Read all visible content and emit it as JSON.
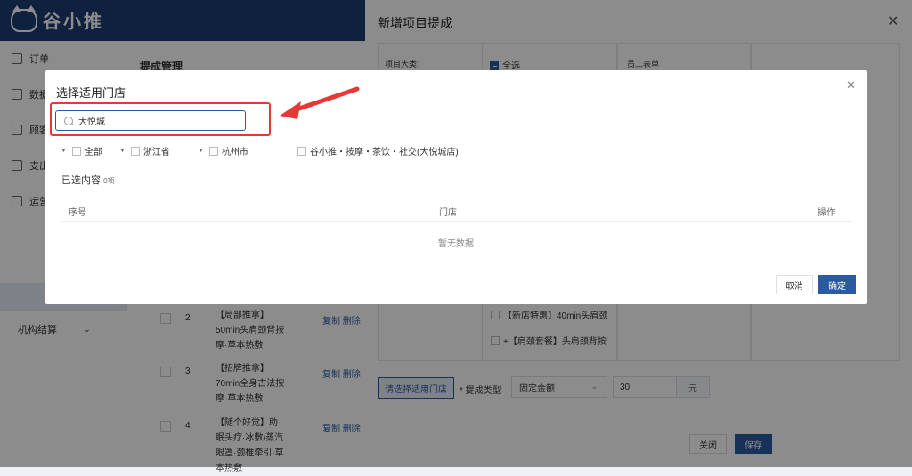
{
  "app": {
    "logo_text": "谷小推"
  },
  "sidebar": {
    "items": [
      {
        "label": "订单"
      },
      {
        "label": "数据"
      },
      {
        "label": "顾客"
      },
      {
        "label": "支出"
      },
      {
        "label": "运营"
      },
      {
        "label": "机构结算"
      }
    ]
  },
  "page": {
    "title": "提成管理",
    "rows": [
      {
        "num": "2",
        "text": "【局部推拿】50min头肩颈背按摩·草本热敷",
        "edit": "复制",
        "del": "删除"
      },
      {
        "num": "3",
        "text": "【招牌推拿】70min全身古法按摩·草本热敷",
        "edit": "复制",
        "del": "删除"
      },
      {
        "num": "4",
        "text": "【随个好觉】助眠头疗·冰敷/蒸汽眼罩·颈椎牵引·草本热敷",
        "edit": "复制",
        "del": "删除"
      }
    ]
  },
  "drawer": {
    "title": "新增项目提成",
    "col1_label": "项目大类：",
    "select_all": "全选",
    "col3_label": "员工表单",
    "items": [
      "【新店特惠】40min头肩颈",
      "+【肩颈套餐】头肩颈背按"
    ],
    "store_button": "请选择适用门店",
    "type_label": "* 提成类型",
    "type_value": "固定金额",
    "amount": "30",
    "unit": "元",
    "close_button": "关闭",
    "save_button": "保存"
  },
  "modal": {
    "title": "选择适用门店",
    "search_value": "大悦城",
    "filters": [
      "全部",
      "浙江省",
      "杭州市"
    ],
    "store_option": "谷小推・按摩・茶饮・社交(大悦城店)",
    "selected_label": "已选内容",
    "selected_count": "0项",
    "columns": [
      "序号",
      "门店",
      "操作"
    ],
    "empty_text": "暂无数据",
    "cancel_button": "取消",
    "ok_button": "确定"
  },
  "colors": {
    "primary": "#2c5aa0",
    "topbar": "#1d3d73",
    "highlight": "#e53935"
  }
}
